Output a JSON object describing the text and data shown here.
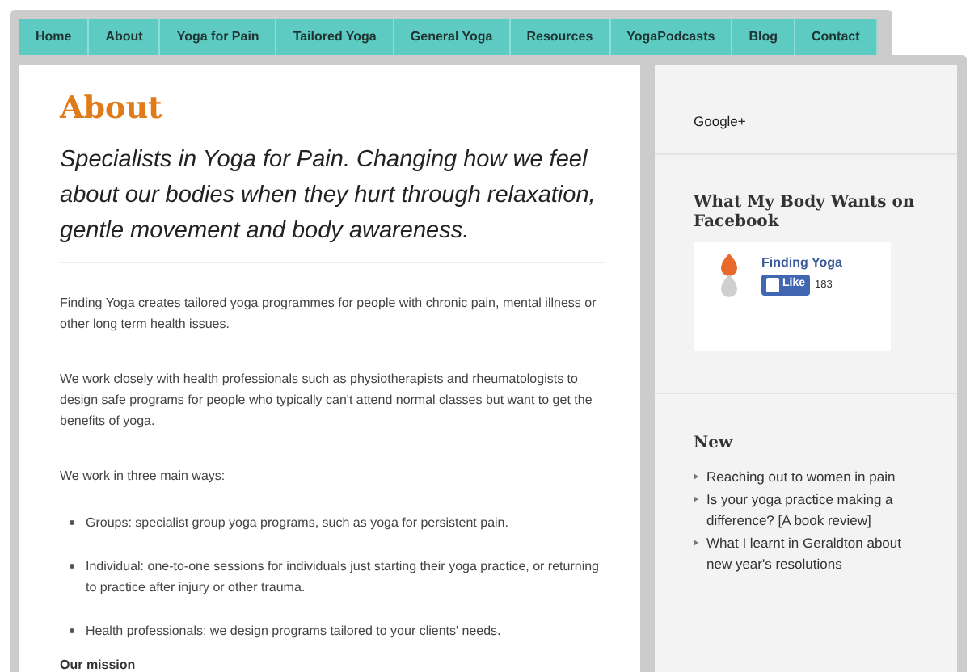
{
  "nav": [
    "Home",
    "About",
    "Yoga for Pain",
    "Tailored Yoga",
    "General Yoga",
    "Resources",
    "YogaPodcasts",
    "Blog",
    "Contact"
  ],
  "main": {
    "title": "About",
    "tagline": "Specialists in Yoga for Pain. Changing how we feel about our bodies when they hurt through relaxation, gentle movement and body awareness.",
    "paragraphs": [
      "Finding Yoga creates tailored yoga programmes for people with chronic pain, mental illness or other long term health issues.",
      "We work closely with health professionals such as physiotherapists and rheumatologists to design safe programs for people who typically can't attend normal classes but want to get the benefits of yoga.",
      "We work in three main ways:"
    ],
    "bullets": [
      "Groups: specialist group yoga programs, such as yoga for persistent pain.",
      "Individual: one-to-one sessions for individuals just starting their yoga practice, or returning to practice after injury or other trauma.",
      "Health professionals: we design programs tailored to your clients' needs."
    ],
    "subheading": "Our mission"
  },
  "sidebar": {
    "google_plus": "Google+",
    "facebook": {
      "heading": "What My Body Wants on Facebook",
      "page_name": "Finding Yoga",
      "like_label": "Like",
      "like_count": "183"
    },
    "new": {
      "heading": "New",
      "links": [
        "Reaching out to women in pain",
        "Is your yoga practice making a difference? [A book review]",
        "What I learnt in Geraldton about new year's resolutions"
      ]
    }
  }
}
